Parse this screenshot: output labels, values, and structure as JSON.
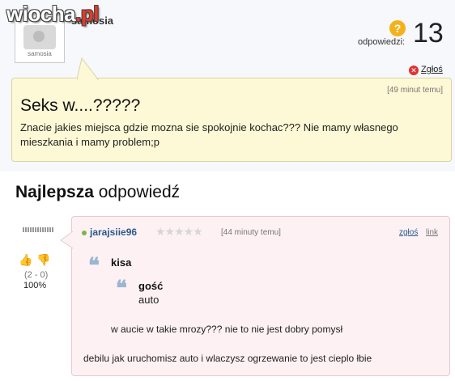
{
  "watermark": {
    "text": "wiocha",
    "suffix": ".pl"
  },
  "question_author": {
    "avatar_caption": "samosia",
    "name": "samosia"
  },
  "answers": {
    "label": "odpowiedzi:",
    "count": "13"
  },
  "report_label": "Zgłoś",
  "question": {
    "time": "[49 minut temu]",
    "title": "Seks w....?????",
    "body": "Znacie jakies miejsca gdzie mozna sie spokojnie kochac??? Nie mamy własnego mieszkania i mamy problem;p"
  },
  "best_answer": {
    "heading_bold": "Najlepsza",
    "heading_rest": " odpowiedź",
    "votes": "(2 - 0)",
    "percent": "100%",
    "author": "jarajsiie96",
    "rating_stars": "★★★★★",
    "time": "[44 minuty temu]",
    "report": "zgłoś",
    "link": "link",
    "quote1_name": "kisa",
    "quote2_name": "gość",
    "quote2_text": "auto",
    "line1": "w aucie w takie mrozy??? nie to nie jest dobry pomysł",
    "line2": "debilu jak uruchomisz auto i wlaczysz ogrzewanie to jest cieplo łbie"
  },
  "colors": {
    "question_bg": "#fdf8d5",
    "answer_bg": "#fdf1f3",
    "username": "#2a5a8a",
    "online": "#7ab648"
  }
}
